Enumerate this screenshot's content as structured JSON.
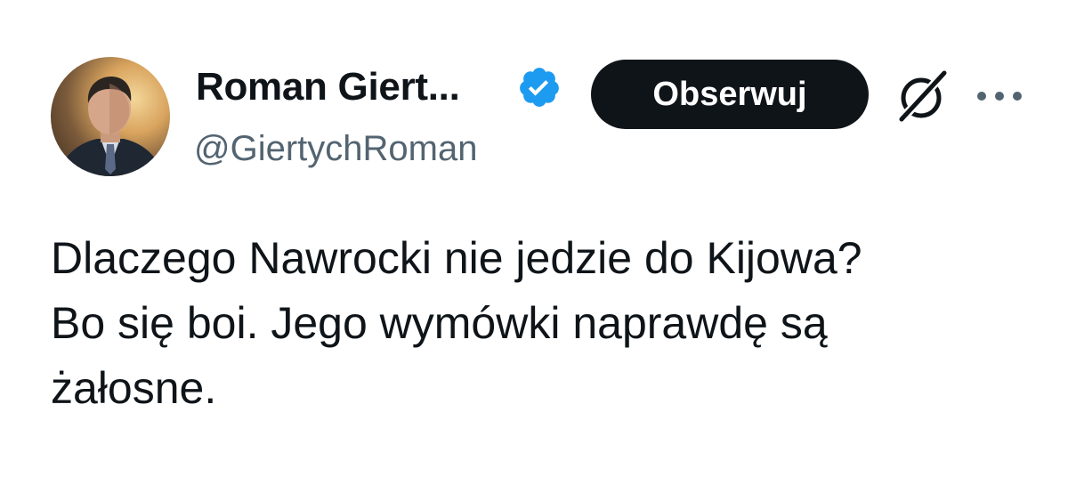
{
  "author": {
    "display_name": "Roman Giert...",
    "handle": "@GiertychRoman",
    "verified": true,
    "avatar_icon": "profile-photo"
  },
  "actions": {
    "follow_label": "Obserwuj",
    "grok_icon": "grok-icon",
    "more_icon": "more-options-icon"
  },
  "tweet": {
    "lines": [
      "Dlaczego Nawrocki nie jedzie do Kijowa?",
      "Bo się boi. Jego wymówki naprawdę są",
      "żałosne."
    ]
  },
  "colors": {
    "text": "#0f1419",
    "handle": "#536471",
    "verified": "#1d9bf0",
    "button_bg": "#0f1419",
    "button_text": "#ffffff"
  }
}
